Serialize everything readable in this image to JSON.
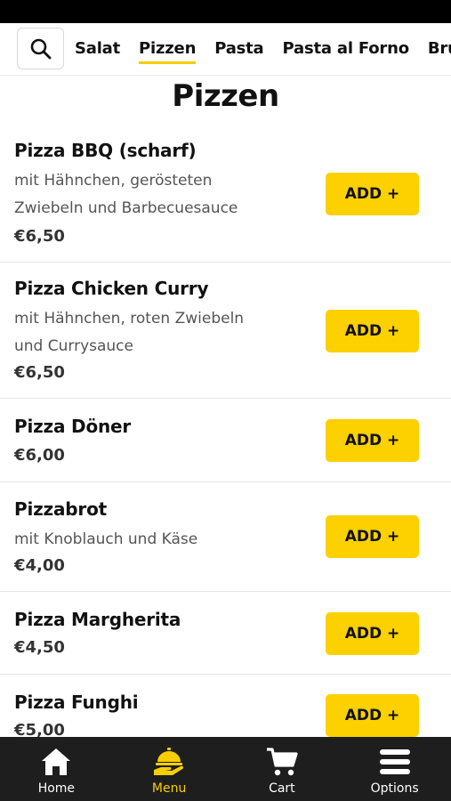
{
  "categories": [
    {
      "label": "Salat",
      "active": false
    },
    {
      "label": "Pizzen",
      "active": true
    },
    {
      "label": "Pasta",
      "active": false
    },
    {
      "label": "Pasta al Forno",
      "active": false
    },
    {
      "label": "Bru",
      "active": false
    }
  ],
  "section_title": "Pizzen",
  "items": [
    {
      "name": "Pizza BBQ (scharf)",
      "desc_lines": [
        "mit Hähnchen, gerösteten",
        "Zwiebeln und Barbecuesauce"
      ],
      "price": "€6,50",
      "add_label": "ADD +"
    },
    {
      "name": "Pizza Chicken Curry",
      "desc_lines": [
        "mit Hähnchen, roten Zwiebeln",
        "und Currysauce"
      ],
      "price": "€6,50",
      "add_label": "ADD +"
    },
    {
      "name": "Pizza Döner",
      "desc_lines": [],
      "price": "€6,00",
      "add_label": "ADD +"
    },
    {
      "name": "Pizzabrot",
      "desc_lines": [
        "mit Knoblauch und Käse"
      ],
      "price": "€4,00",
      "add_label": "ADD +"
    },
    {
      "name": "Pizza Margherita",
      "desc_lines": [],
      "price": "€4,50",
      "add_label": "ADD +"
    },
    {
      "name": "Pizza Funghi",
      "desc_lines": [],
      "price": "€5,00",
      "add_label": "ADD +"
    }
  ],
  "bottom_nav": [
    {
      "label": "Home",
      "icon": "home-icon",
      "active": false
    },
    {
      "label": "Menu",
      "icon": "serving-hand-icon",
      "active": true
    },
    {
      "label": "Cart",
      "icon": "cart-icon",
      "active": false
    },
    {
      "label": "Options",
      "icon": "menu-bars-icon",
      "active": false
    }
  ],
  "colors": {
    "accent": "#fdd000",
    "nav_bg": "#1e1e1e",
    "status_bar": "#000000"
  }
}
